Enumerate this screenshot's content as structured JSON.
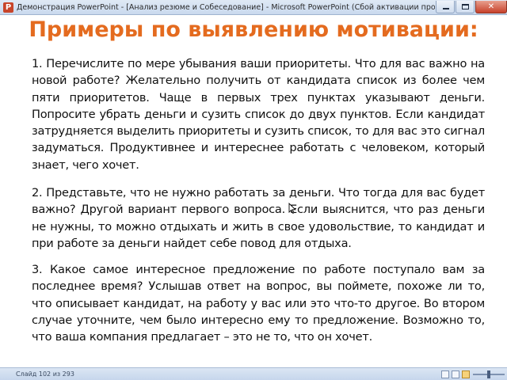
{
  "window": {
    "app_icon_letter": "P",
    "title": "Демонстрация PowerPoint - [Анализ резюме и Собеседование] - Microsoft PowerPoint (Сбой активации продукт..."
  },
  "slide": {
    "title": "Примеры по выявлению мотивации:",
    "paragraphs": [
      "1. Перечислите по мере убывания ваши приоритеты. Что для вас важно на новой работе? Желательно получить от кандидата список из более чем пяти приоритетов. Чаще в первых трех пунктах указывают деньги. Попросите убрать деньги и сузить список до двух пунктов. Если кандидат затрудняется выделить приоритеты и сузить список, то для вас это сигнал задуматься. Продуктивнее и интереснее работать с человеком, который знает, чего хочет.",
      "2. Представьте, что не нужно работать за деньги. Что тогда для вас будет важно? Другой вариант первого вопроса. Если выяснится, что раз деньги не нужны, то можно отдыхать и жить в свое удовольствие, то кандидат и при работе за деньги найдет себе повод для отдыха.",
      "3. Какое самое интересное предложение по работе поступало вам за последнее время? Услышав ответ на вопрос, вы поймете, похоже ли то, что описывает кандидат, на работу у вас или это что-то другое. Во втором случае уточните, чем было интересно ему то предложение. Возможно то, что ваша компания предлагает – это не то, что он хочет."
    ]
  },
  "statusbar": {
    "slide_counter": "Слайд 102 из 293"
  },
  "colors": {
    "title": "#e46b1f",
    "body_text": "#111111",
    "close_button": "#c7412b"
  }
}
